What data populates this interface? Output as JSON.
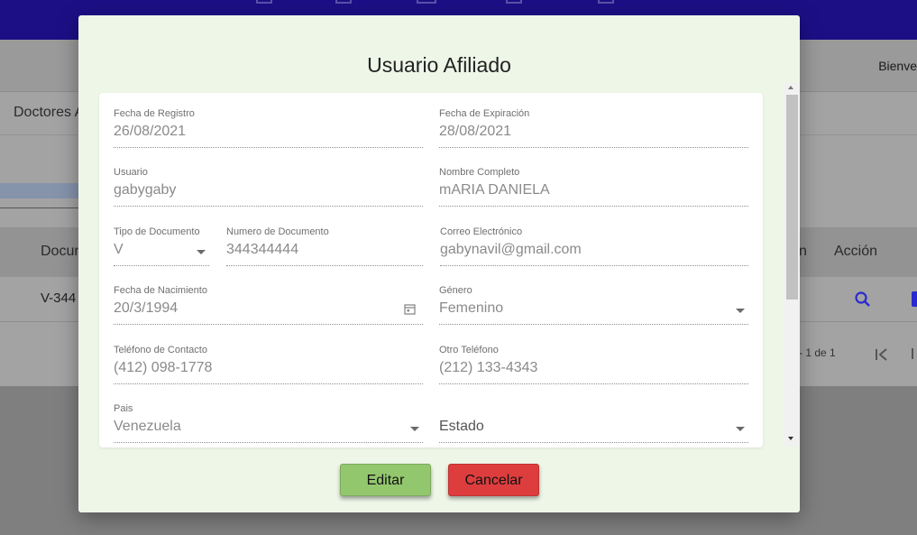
{
  "app": {
    "welcome_text": "Bienve",
    "page_tab": "Doctores A",
    "table": {
      "col_document": "Docun",
      "col_partial": "n",
      "col_action": "Acción",
      "row_document": "V-344",
      "pager_text": "- 1 de 1"
    }
  },
  "modal": {
    "title": "Usuario Afiliado",
    "fields": {
      "fecha_registro": {
        "label": "Fecha de Registro",
        "value": "26/08/2021"
      },
      "fecha_expiracion": {
        "label": "Fecha de Expiración",
        "value": "28/08/2021"
      },
      "usuario": {
        "label": "Usuario",
        "value": "gabygaby"
      },
      "nombre_completo": {
        "label": "Nombre Completo",
        "value": "mARIA DANIELA"
      },
      "tipo_documento": {
        "label": "Tipo de Documento",
        "value": "V"
      },
      "numero_documento": {
        "label": "Numero de Documento",
        "value": "344344444"
      },
      "correo": {
        "label": "Correo Electrónico",
        "value": "gabynavil@gmail.com"
      },
      "fecha_nacimiento": {
        "label": "Fecha de Nacimiento",
        "value": "20/3/1994"
      },
      "genero": {
        "label": "Género",
        "value": "Femenino"
      },
      "telefono_contacto": {
        "label": "Teléfono de Contacto",
        "value": "(412) 098-1778"
      },
      "otro_telefono": {
        "label": "Otro Teléfono",
        "value": "(212) 133-4343"
      },
      "pais": {
        "label": "Pais",
        "value": "Venezuela"
      },
      "estado": {
        "label": "",
        "value": "Estado"
      }
    },
    "buttons": {
      "edit": "Editar",
      "cancel": "Cancelar"
    }
  },
  "colors": {
    "topbar": "#1c0f86",
    "modal_bg": "#eef6e8",
    "edit_button": "#93c76e",
    "cancel_button": "#de3d3d",
    "action_icon": "#2a2ad0"
  },
  "icons": [
    "search-icon",
    "first-page-icon",
    "calendar-icon",
    "dropdown-caret-icon"
  ]
}
